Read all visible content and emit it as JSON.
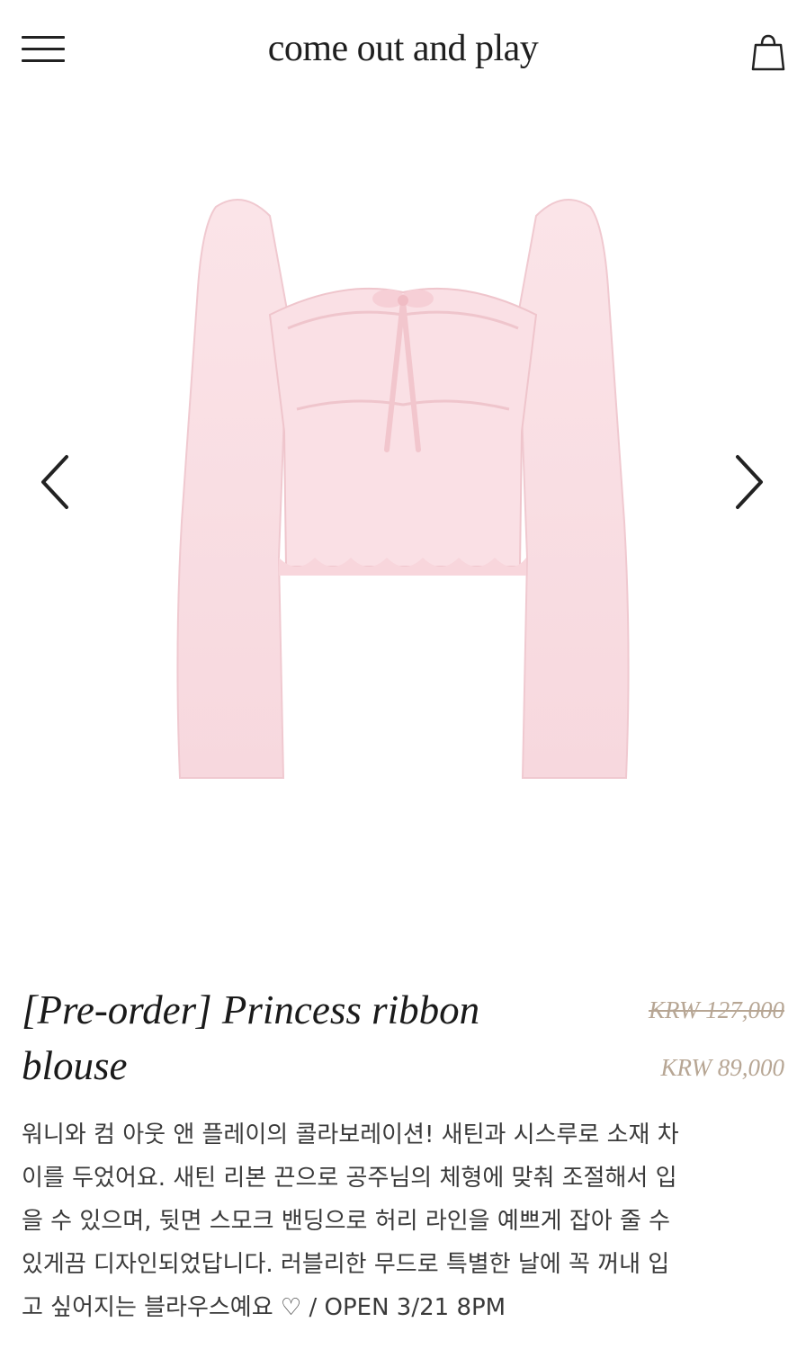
{
  "header": {
    "brand": "come out and play",
    "menu_icon": "hamburger-menu-icon",
    "cart_icon": "shopping-bag-icon"
  },
  "gallery": {
    "prev_icon": "chevron-left-icon",
    "next_icon": "chevron-right-icon",
    "image_color": "#f8dde2"
  },
  "product": {
    "title_line1": "[Pre-order] Princess ribbon",
    "title_line2": "blouse",
    "original_price": "KRW 127,000",
    "sale_price": "KRW 89,000",
    "description": [
      "워니와 컴 아웃 앤 플레이의 콜라보레이션! 새틴과 시스루로 소재 차",
      "이를 두었어요. 새틴 리본 끈으로 공주님의 체형에 맞춰 조절해서 입",
      "을 수 있으며, 뒷면 스모크 밴딩으로 허리 라인을 예쁘게 잡아 줄 수",
      "있게끔 디자인되었답니다. 러블리한 무드로 특별한 날에 꼭 꺼내 입",
      "고 싶어지는 블라우스예요 ♡ / OPEN 3/21 8PM"
    ]
  },
  "colors": {
    "price": "#b7a694",
    "text": "#1f1f1f"
  }
}
